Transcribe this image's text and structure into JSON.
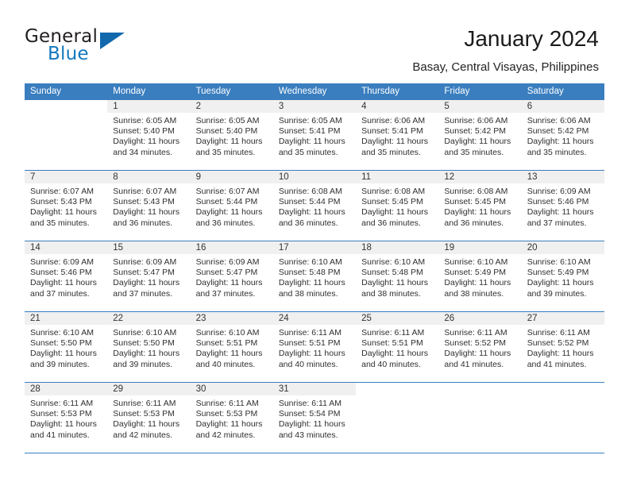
{
  "brand": {
    "name_part1": "General",
    "name_part2": "Blue",
    "triangle_color": "#1268ad"
  },
  "header": {
    "title": "January 2024",
    "subtitle": "Basay, Central Visayas, Philippines"
  },
  "theme": {
    "header_row_bg": "#3a7ebf",
    "daynum_bg": "#f0f0f0",
    "text": "#2f2f2f"
  },
  "weekdays": [
    "Sunday",
    "Monday",
    "Tuesday",
    "Wednesday",
    "Thursday",
    "Friday",
    "Saturday"
  ],
  "labels": {
    "sunrise_prefix": "Sunrise:",
    "sunset_prefix": "Sunset:",
    "daylight_prefix": "Daylight:"
  },
  "weeks": [
    [
      {
        "day": "",
        "sunrise": "",
        "sunset": "",
        "daylight": ""
      },
      {
        "day": "1",
        "sunrise": "Sunrise: 6:05 AM",
        "sunset": "Sunset: 5:40 PM",
        "daylight": "Daylight: 11 hours and 34 minutes."
      },
      {
        "day": "2",
        "sunrise": "Sunrise: 6:05 AM",
        "sunset": "Sunset: 5:40 PM",
        "daylight": "Daylight: 11 hours and 35 minutes."
      },
      {
        "day": "3",
        "sunrise": "Sunrise: 6:05 AM",
        "sunset": "Sunset: 5:41 PM",
        "daylight": "Daylight: 11 hours and 35 minutes."
      },
      {
        "day": "4",
        "sunrise": "Sunrise: 6:06 AM",
        "sunset": "Sunset: 5:41 PM",
        "daylight": "Daylight: 11 hours and 35 minutes."
      },
      {
        "day": "5",
        "sunrise": "Sunrise: 6:06 AM",
        "sunset": "Sunset: 5:42 PM",
        "daylight": "Daylight: 11 hours and 35 minutes."
      },
      {
        "day": "6",
        "sunrise": "Sunrise: 6:06 AM",
        "sunset": "Sunset: 5:42 PM",
        "daylight": "Daylight: 11 hours and 35 minutes."
      }
    ],
    [
      {
        "day": "7",
        "sunrise": "Sunrise: 6:07 AM",
        "sunset": "Sunset: 5:43 PM",
        "daylight": "Daylight: 11 hours and 35 minutes."
      },
      {
        "day": "8",
        "sunrise": "Sunrise: 6:07 AM",
        "sunset": "Sunset: 5:43 PM",
        "daylight": "Daylight: 11 hours and 36 minutes."
      },
      {
        "day": "9",
        "sunrise": "Sunrise: 6:07 AM",
        "sunset": "Sunset: 5:44 PM",
        "daylight": "Daylight: 11 hours and 36 minutes."
      },
      {
        "day": "10",
        "sunrise": "Sunrise: 6:08 AM",
        "sunset": "Sunset: 5:44 PM",
        "daylight": "Daylight: 11 hours and 36 minutes."
      },
      {
        "day": "11",
        "sunrise": "Sunrise: 6:08 AM",
        "sunset": "Sunset: 5:45 PM",
        "daylight": "Daylight: 11 hours and 36 minutes."
      },
      {
        "day": "12",
        "sunrise": "Sunrise: 6:08 AM",
        "sunset": "Sunset: 5:45 PM",
        "daylight": "Daylight: 11 hours and 36 minutes."
      },
      {
        "day": "13",
        "sunrise": "Sunrise: 6:09 AM",
        "sunset": "Sunset: 5:46 PM",
        "daylight": "Daylight: 11 hours and 37 minutes."
      }
    ],
    [
      {
        "day": "14",
        "sunrise": "Sunrise: 6:09 AM",
        "sunset": "Sunset: 5:46 PM",
        "daylight": "Daylight: 11 hours and 37 minutes."
      },
      {
        "day": "15",
        "sunrise": "Sunrise: 6:09 AM",
        "sunset": "Sunset: 5:47 PM",
        "daylight": "Daylight: 11 hours and 37 minutes."
      },
      {
        "day": "16",
        "sunrise": "Sunrise: 6:09 AM",
        "sunset": "Sunset: 5:47 PM",
        "daylight": "Daylight: 11 hours and 37 minutes."
      },
      {
        "day": "17",
        "sunrise": "Sunrise: 6:10 AM",
        "sunset": "Sunset: 5:48 PM",
        "daylight": "Daylight: 11 hours and 38 minutes."
      },
      {
        "day": "18",
        "sunrise": "Sunrise: 6:10 AM",
        "sunset": "Sunset: 5:48 PM",
        "daylight": "Daylight: 11 hours and 38 minutes."
      },
      {
        "day": "19",
        "sunrise": "Sunrise: 6:10 AM",
        "sunset": "Sunset: 5:49 PM",
        "daylight": "Daylight: 11 hours and 38 minutes."
      },
      {
        "day": "20",
        "sunrise": "Sunrise: 6:10 AM",
        "sunset": "Sunset: 5:49 PM",
        "daylight": "Daylight: 11 hours and 39 minutes."
      }
    ],
    [
      {
        "day": "21",
        "sunrise": "Sunrise: 6:10 AM",
        "sunset": "Sunset: 5:50 PM",
        "daylight": "Daylight: 11 hours and 39 minutes."
      },
      {
        "day": "22",
        "sunrise": "Sunrise: 6:10 AM",
        "sunset": "Sunset: 5:50 PM",
        "daylight": "Daylight: 11 hours and 39 minutes."
      },
      {
        "day": "23",
        "sunrise": "Sunrise: 6:10 AM",
        "sunset": "Sunset: 5:51 PM",
        "daylight": "Daylight: 11 hours and 40 minutes."
      },
      {
        "day": "24",
        "sunrise": "Sunrise: 6:11 AM",
        "sunset": "Sunset: 5:51 PM",
        "daylight": "Daylight: 11 hours and 40 minutes."
      },
      {
        "day": "25",
        "sunrise": "Sunrise: 6:11 AM",
        "sunset": "Sunset: 5:51 PM",
        "daylight": "Daylight: 11 hours and 40 minutes."
      },
      {
        "day": "26",
        "sunrise": "Sunrise: 6:11 AM",
        "sunset": "Sunset: 5:52 PM",
        "daylight": "Daylight: 11 hours and 41 minutes."
      },
      {
        "day": "27",
        "sunrise": "Sunrise: 6:11 AM",
        "sunset": "Sunset: 5:52 PM",
        "daylight": "Daylight: 11 hours and 41 minutes."
      }
    ],
    [
      {
        "day": "28",
        "sunrise": "Sunrise: 6:11 AM",
        "sunset": "Sunset: 5:53 PM",
        "daylight": "Daylight: 11 hours and 41 minutes."
      },
      {
        "day": "29",
        "sunrise": "Sunrise: 6:11 AM",
        "sunset": "Sunset: 5:53 PM",
        "daylight": "Daylight: 11 hours and 42 minutes."
      },
      {
        "day": "30",
        "sunrise": "Sunrise: 6:11 AM",
        "sunset": "Sunset: 5:53 PM",
        "daylight": "Daylight: 11 hours and 42 minutes."
      },
      {
        "day": "31",
        "sunrise": "Sunrise: 6:11 AM",
        "sunset": "Sunset: 5:54 PM",
        "daylight": "Daylight: 11 hours and 43 minutes."
      },
      {
        "day": "",
        "sunrise": "",
        "sunset": "",
        "daylight": ""
      },
      {
        "day": "",
        "sunrise": "",
        "sunset": "",
        "daylight": ""
      },
      {
        "day": "",
        "sunrise": "",
        "sunset": "",
        "daylight": ""
      }
    ]
  ]
}
